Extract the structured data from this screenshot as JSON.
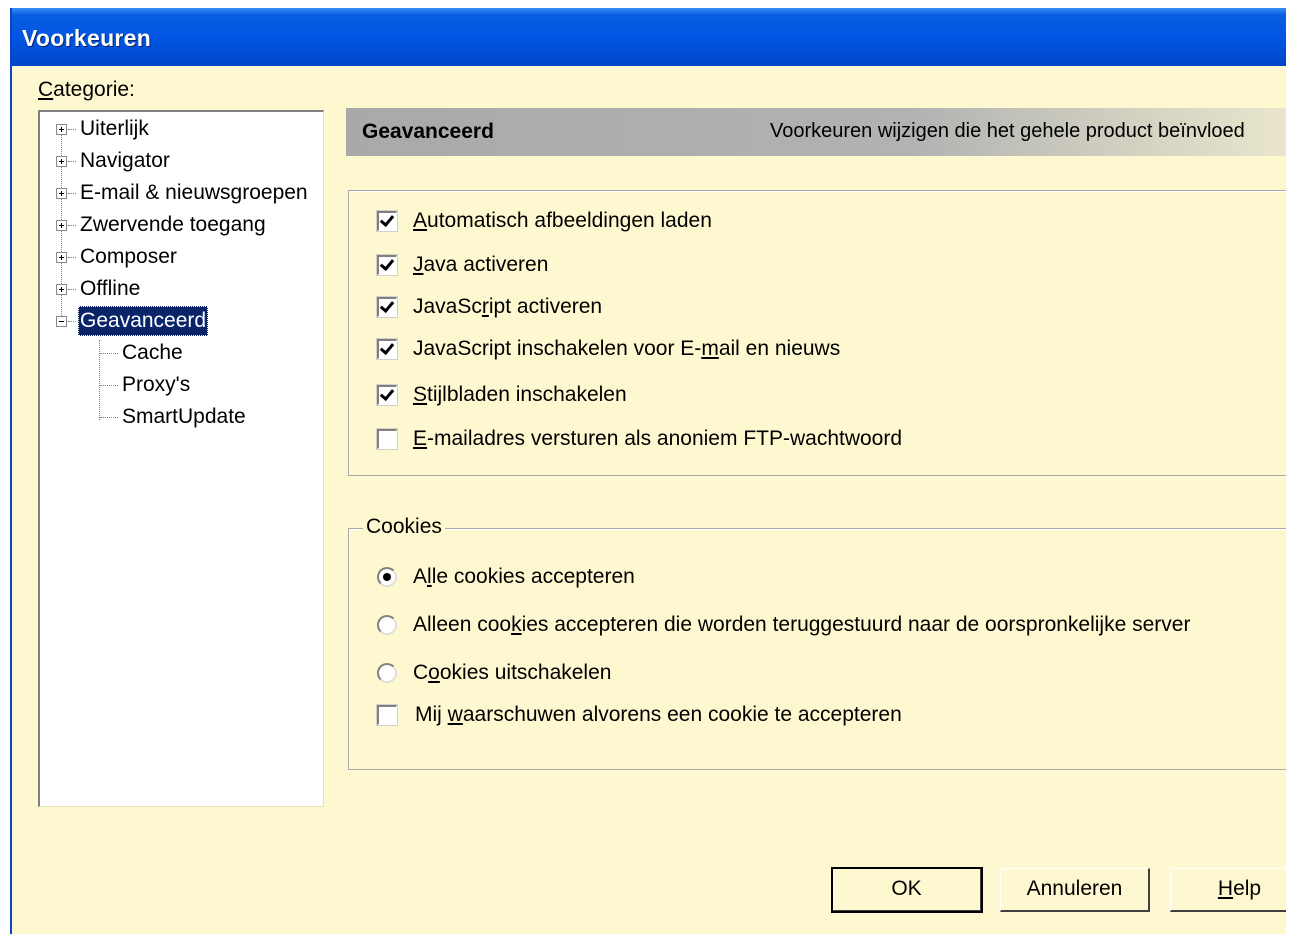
{
  "window": {
    "title": "Voorkeuren"
  },
  "category": {
    "label_prefix": "C",
    "label_rest": "ategorie:",
    "tree": [
      {
        "label": "Uiterlijk",
        "expander": "plus"
      },
      {
        "label": "Navigator",
        "expander": "plus"
      },
      {
        "label": "E-mail & nieuwsgroepen",
        "expander": "plus"
      },
      {
        "label": "Zwervende toegang",
        "expander": "plus"
      },
      {
        "label": "Composer",
        "expander": "plus"
      },
      {
        "label": "Offline",
        "expander": "plus"
      },
      {
        "label": "Geavanceerd",
        "expander": "minus",
        "selected": true
      },
      {
        "label": "Cache",
        "child": true
      },
      {
        "label": "Proxy's",
        "child": true
      },
      {
        "label": "SmartUpdate",
        "child": true
      }
    ]
  },
  "header": {
    "title": "Geavanceerd",
    "description": "Voorkeuren wijzigen die het gehele product beïnvloed"
  },
  "options": {
    "auto_images": {
      "checked": true,
      "pre": "",
      "u": "A",
      "post": "utomatisch afbeeldingen laden"
    },
    "java": {
      "checked": true,
      "pre": "",
      "u": "J",
      "post": "ava activeren"
    },
    "javascript": {
      "checked": true,
      "pre": "JavaSc",
      "u": "r",
      "post": "ipt activeren"
    },
    "javascript_mail": {
      "checked": true,
      "pre": "JavaScript inschakelen voor E-",
      "u": "m",
      "post": "ail en nieuws"
    },
    "stylesheets": {
      "checked": true,
      "pre": "",
      "u": "S",
      "post": "tijlbladen inschakelen"
    },
    "anon_ftp": {
      "checked": false,
      "pre": "",
      "u": "E",
      "post": "-mailadres versturen als anoniem FTP-wachtwoord"
    }
  },
  "cookies": {
    "legend": "Cookies",
    "accept_all": {
      "selected": true,
      "pre": "A",
      "u": "l",
      "post": "le cookies accepteren"
    },
    "accept_origin": {
      "selected": false,
      "pre": "Alleen coo",
      "u": "k",
      "post": "ies accepteren die worden teruggestuurd naar de oorspronkelijke server"
    },
    "disable": {
      "selected": false,
      "pre": "C",
      "u": "o",
      "post": "okies uitschakelen"
    },
    "warn": {
      "checked": false,
      "pre": "Mij ",
      "u": "w",
      "post": "aarschuwen alvorens een cookie te accepteren"
    }
  },
  "buttons": {
    "ok": "OK",
    "cancel": "Annuleren",
    "help_u": "H",
    "help_rest": "elp"
  }
}
